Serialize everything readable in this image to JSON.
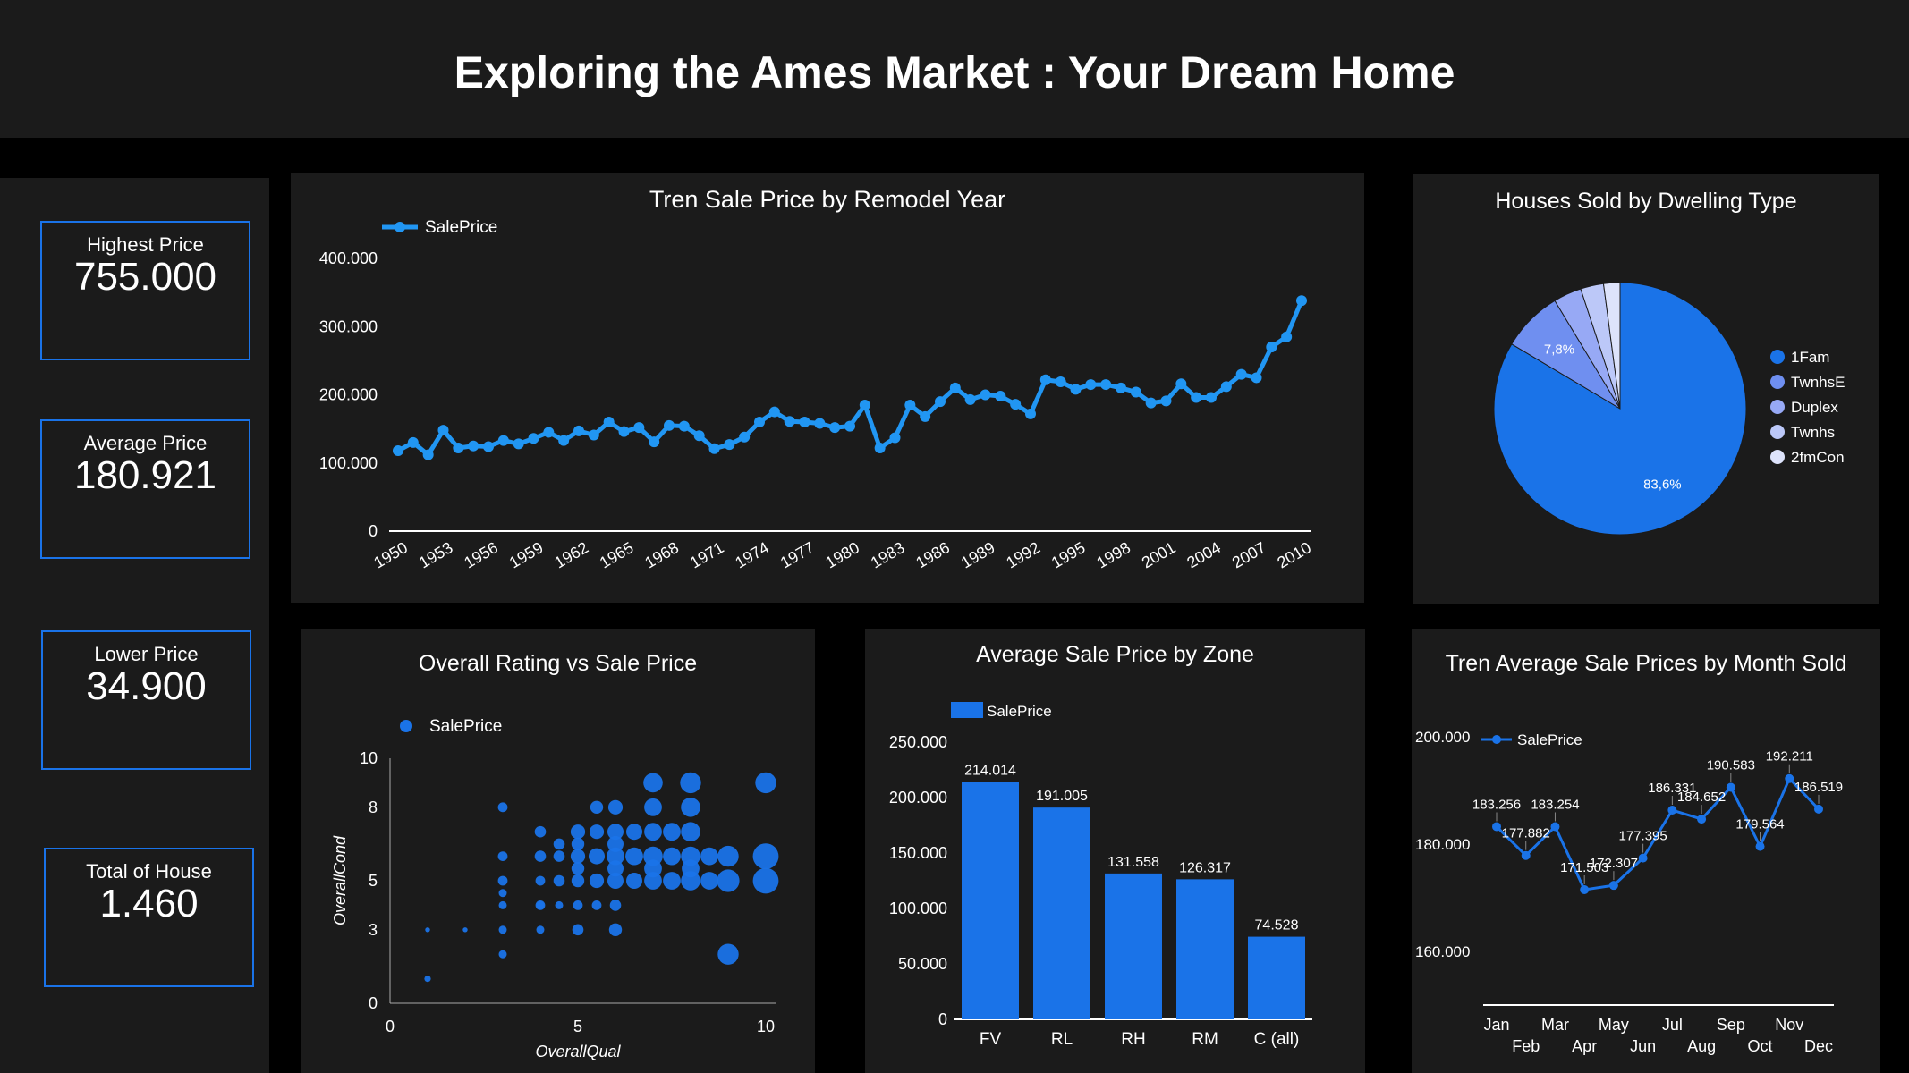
{
  "title": "Exploring the Ames Market : Your Dream Home",
  "kpis": [
    {
      "label": "Highest Price",
      "value": "755.000"
    },
    {
      "label": "Average Price",
      "value": "180.921"
    },
    {
      "label": "Lower Price",
      "value": "34.900"
    },
    {
      "label": "Total of House",
      "value": "1.460"
    }
  ],
  "colors": {
    "accent": "#1a73e8",
    "line": "#2196f3",
    "panel": "#1b1b1b",
    "background": "#000000"
  },
  "chart_data": [
    {
      "id": "remodel",
      "type": "line",
      "title": "Tren Sale Price by Remodel Year",
      "legend": "SalePrice",
      "legend_position": "top-left",
      "x": [
        1950,
        1951,
        1952,
        1953,
        1954,
        1955,
        1956,
        1957,
        1958,
        1959,
        1960,
        1961,
        1962,
        1963,
        1964,
        1965,
        1966,
        1967,
        1968,
        1969,
        1970,
        1971,
        1972,
        1973,
        1974,
        1975,
        1976,
        1977,
        1978,
        1979,
        1980,
        1981,
        1982,
        1983,
        1984,
        1985,
        1986,
        1987,
        1988,
        1989,
        1990,
        1991,
        1992,
        1993,
        1994,
        1995,
        1996,
        1997,
        1998,
        1999,
        2000,
        2001,
        2002,
        2003,
        2004,
        2005,
        2006,
        2007,
        2008,
        2009,
        2010
      ],
      "values": [
        118000,
        130000,
        112000,
        148000,
        122000,
        125000,
        124000,
        133000,
        128000,
        136000,
        145000,
        133000,
        147000,
        141000,
        160000,
        146000,
        152000,
        131000,
        155000,
        154000,
        140000,
        121000,
        127000,
        138000,
        160000,
        175000,
        161000,
        160000,
        158000,
        152000,
        154000,
        185000,
        122000,
        137000,
        185000,
        168000,
        190000,
        210000,
        193000,
        200000,
        198000,
        186000,
        172000,
        222000,
        219000,
        208000,
        215000,
        215000,
        210000,
        204000,
        188000,
        191000,
        216000,
        196000,
        196000,
        212000,
        230000,
        225000,
        270000,
        285000,
        338000
      ],
      "ticks_x": [
        "1950",
        "1953",
        "1956",
        "1959",
        "1962",
        "1965",
        "1968",
        "1971",
        "1974",
        "1977",
        "1980",
        "1983",
        "1986",
        "1989",
        "1992",
        "1995",
        "1998",
        "2001",
        "2004",
        "2007",
        "2010"
      ],
      "ticks_y": [
        "0",
        "100.000",
        "200.000",
        "300.000",
        "400.000"
      ],
      "ylim": [
        0,
        400000
      ]
    },
    {
      "id": "dwelling",
      "type": "pie",
      "title": "Houses Sold by Dwelling Type",
      "legend_position": "right",
      "labels": [
        "1Fam",
        "TwnhsE",
        "Duplex",
        "Twnhs",
        "2fmCon"
      ],
      "values": [
        83.6,
        7.8,
        3.6,
        2.96,
        2.1
      ],
      "slice_labels": [
        "83,6%",
        "7,8%",
        "",
        "",
        ""
      ],
      "colors": [
        "#1a73e8",
        "#6f8ff0",
        "#97a9f5",
        "#bcc8f8",
        "#dde3fb"
      ]
    },
    {
      "id": "rating",
      "type": "scatter",
      "title": "Overall Rating vs Sale Price",
      "legend": "SalePrice",
      "xlabel": "OverallQual",
      "ylabel": "OverallCond",
      "xlim": [
        0,
        10
      ],
      "ylim": [
        0,
        10
      ],
      "ticks_x": [
        "0",
        "5",
        "10"
      ],
      "ticks_y": [
        "0",
        "3",
        "5",
        "8",
        "10"
      ],
      "points": [
        [
          1,
          1,
          4
        ],
        [
          1,
          3,
          3
        ],
        [
          2,
          3,
          3
        ],
        [
          3,
          2,
          5
        ],
        [
          3,
          3,
          5
        ],
        [
          3,
          4,
          5
        ],
        [
          3,
          4.5,
          5
        ],
        [
          3,
          5,
          6
        ],
        [
          3,
          6,
          6
        ],
        [
          3,
          8,
          6
        ],
        [
          4,
          3,
          5
        ],
        [
          4,
          4,
          6
        ],
        [
          4,
          5,
          6
        ],
        [
          4,
          6,
          7
        ],
        [
          4,
          7,
          7
        ],
        [
          4,
          4,
          5
        ],
        [
          4.5,
          4,
          5
        ],
        [
          4.5,
          5,
          7
        ],
        [
          4.5,
          6,
          7
        ],
        [
          4.5,
          6.5,
          7
        ],
        [
          5,
          3,
          7
        ],
        [
          5,
          4,
          6
        ],
        [
          5,
          5,
          8
        ],
        [
          5,
          6,
          9
        ],
        [
          5,
          7,
          9
        ],
        [
          5,
          5.5,
          8
        ],
        [
          5,
          6.5,
          8
        ],
        [
          5.5,
          4,
          6
        ],
        [
          5.5,
          5,
          9
        ],
        [
          5.5,
          6,
          10
        ],
        [
          5.5,
          7,
          9
        ],
        [
          5.5,
          8,
          8
        ],
        [
          6,
          3,
          8
        ],
        [
          6,
          4,
          7
        ],
        [
          6,
          5,
          10
        ],
        [
          6,
          6,
          11
        ],
        [
          6,
          7,
          10
        ],
        [
          6,
          8,
          9
        ],
        [
          6,
          5.5,
          10
        ],
        [
          6,
          6.5,
          10
        ],
        [
          6.5,
          5,
          10
        ],
        [
          6.5,
          6,
          11
        ],
        [
          6.5,
          7,
          10
        ],
        [
          7,
          5,
          11
        ],
        [
          7,
          5.5,
          11
        ],
        [
          7,
          6,
          12
        ],
        [
          7,
          7,
          11
        ],
        [
          7,
          8,
          11
        ],
        [
          7,
          9,
          12
        ],
        [
          7.5,
          5,
          11
        ],
        [
          7.5,
          6,
          11
        ],
        [
          7.5,
          7,
          11
        ],
        [
          8,
          5,
          12
        ],
        [
          8,
          5.5,
          11
        ],
        [
          8,
          6,
          12
        ],
        [
          8,
          7,
          12
        ],
        [
          8,
          8,
          12
        ],
        [
          8,
          9,
          13
        ],
        [
          8.5,
          5,
          11
        ],
        [
          8.5,
          6,
          11
        ],
        [
          9,
          2,
          13
        ],
        [
          9,
          5,
          14
        ],
        [
          9,
          6,
          13
        ],
        [
          10,
          5,
          16
        ],
        [
          10,
          6,
          16
        ],
        [
          10,
          9,
          13
        ]
      ]
    },
    {
      "id": "zone",
      "type": "bar",
      "title": "Average Sale Price by Zone",
      "legend": "SalePrice",
      "categories": [
        "FV",
        "RL",
        "RH",
        "RM",
        "C (all)"
      ],
      "values": [
        214014,
        191005,
        131558,
        126317,
        74528
      ],
      "value_labels": [
        "214.014",
        "191.005",
        "131.558",
        "126.317",
        "74.528"
      ],
      "ticks_y": [
        "0",
        "50.000",
        "100.000",
        "150.000",
        "200.000",
        "250.000"
      ],
      "ylim": [
        0,
        250000
      ]
    },
    {
      "id": "month",
      "type": "line",
      "title": "Tren Average Sale Prices by Month Sold",
      "legend": "SalePrice",
      "categories": [
        "Jan",
        "Feb",
        "Mar",
        "Apr",
        "May",
        "Jun",
        "Jul",
        "Aug",
        "Sep",
        "Oct",
        "Nov",
        "Dec"
      ],
      "values": [
        183256,
        177882,
        183254,
        171503,
        172307,
        177395,
        186331,
        184652,
        190583,
        179564,
        192211,
        186519
      ],
      "value_labels": [
        "183.256",
        "177.882",
        "183.254",
        "171.503",
        "172.307",
        "177.395",
        "186.331",
        "184.652",
        "190.583",
        "179.564",
        "192.211",
        "186.519"
      ],
      "ticks_y": [
        "160.000",
        "180.000",
        "200.000"
      ],
      "ylim": [
        150000,
        205000
      ]
    }
  ]
}
